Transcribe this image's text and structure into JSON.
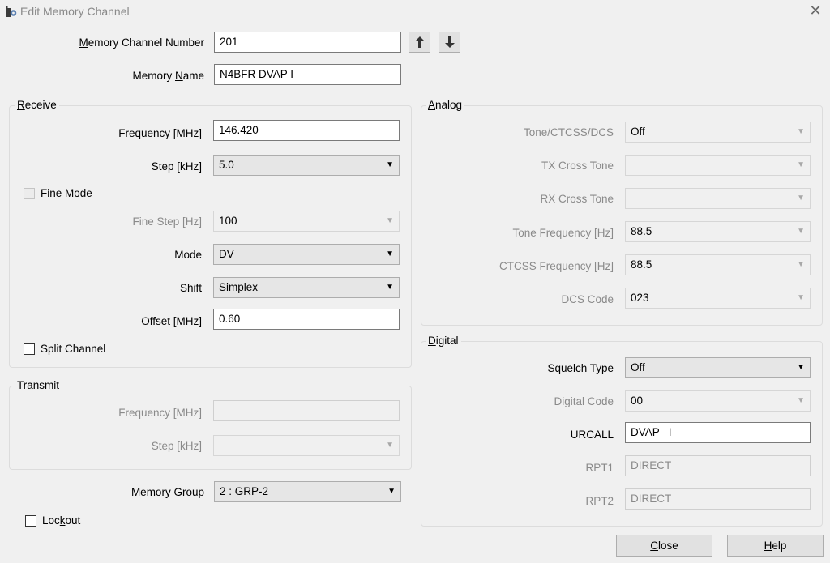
{
  "window": {
    "title": "Edit Memory Channel",
    "icon": "radio-gear-icon",
    "close_icon": "close-icon"
  },
  "channel": {
    "number_label": [
      "",
      "M",
      "emory Channel Number"
    ],
    "number_value": "201",
    "up_icon": "arrow-up-icon",
    "down_icon": "arrow-down-icon",
    "name_label": [
      "Memory ",
      "N",
      "ame"
    ],
    "name_value": "N4BFR DVAP I"
  },
  "receive": {
    "group_label": [
      "",
      "R",
      "eceive"
    ],
    "frequency_label": "Frequency [MHz]",
    "frequency_value": "146.420",
    "step_label": "Step [kHz]",
    "step_value": "5.0",
    "fine_mode_label": "Fine Mode",
    "fine_mode_checked": false,
    "fine_step_label": "Fine Step [Hz]",
    "fine_step_value": "100",
    "mode_label": "Mode",
    "mode_value": "DV",
    "shift_label": "Shift",
    "shift_value": "Simplex",
    "offset_label": "Offset [MHz]",
    "offset_value": "0.60",
    "split_label": "Split Channel",
    "split_checked": false
  },
  "transmit": {
    "group_label": [
      "",
      "T",
      "ransmit"
    ],
    "frequency_label": "Frequency [MHz]",
    "frequency_value": "",
    "step_label": "Step [kHz]",
    "step_value": ""
  },
  "memory_group": {
    "label": [
      "Memory ",
      "G",
      "roup"
    ],
    "value": "2 : GRP-2"
  },
  "lockout": {
    "label": [
      "Loc",
      "k",
      "out"
    ],
    "checked": false
  },
  "analog": {
    "group_label": [
      "",
      "A",
      "nalog"
    ],
    "tone_label": "Tone/CTCSS/DCS",
    "tone_value": "Off",
    "tx_cross_label": "TX Cross Tone",
    "tx_cross_value": "",
    "rx_cross_label": "RX Cross Tone",
    "rx_cross_value": "",
    "tone_freq_label": "Tone Frequency [Hz]",
    "tone_freq_value": "88.5",
    "ctcss_label": "CTCSS Frequency [Hz]",
    "ctcss_value": "88.5",
    "dcs_label": "DCS Code",
    "dcs_value": "023"
  },
  "digital": {
    "group_label": [
      "",
      "D",
      "igital"
    ],
    "squelch_label": "Squelch Type",
    "squelch_value": "Off",
    "digital_code_label": "Digital Code",
    "digital_code_value": "00",
    "urcall_label": "URCALL",
    "urcall_value": "DVAP   I",
    "rpt1_label": "RPT1",
    "rpt1_value": "DIRECT",
    "rpt2_label": "RPT2",
    "rpt2_value": "DIRECT"
  },
  "buttons": {
    "close": [
      "",
      "C",
      "lose"
    ],
    "help": [
      "",
      "H",
      "elp"
    ]
  },
  "dropdown_icon": "chevron-down-icon"
}
